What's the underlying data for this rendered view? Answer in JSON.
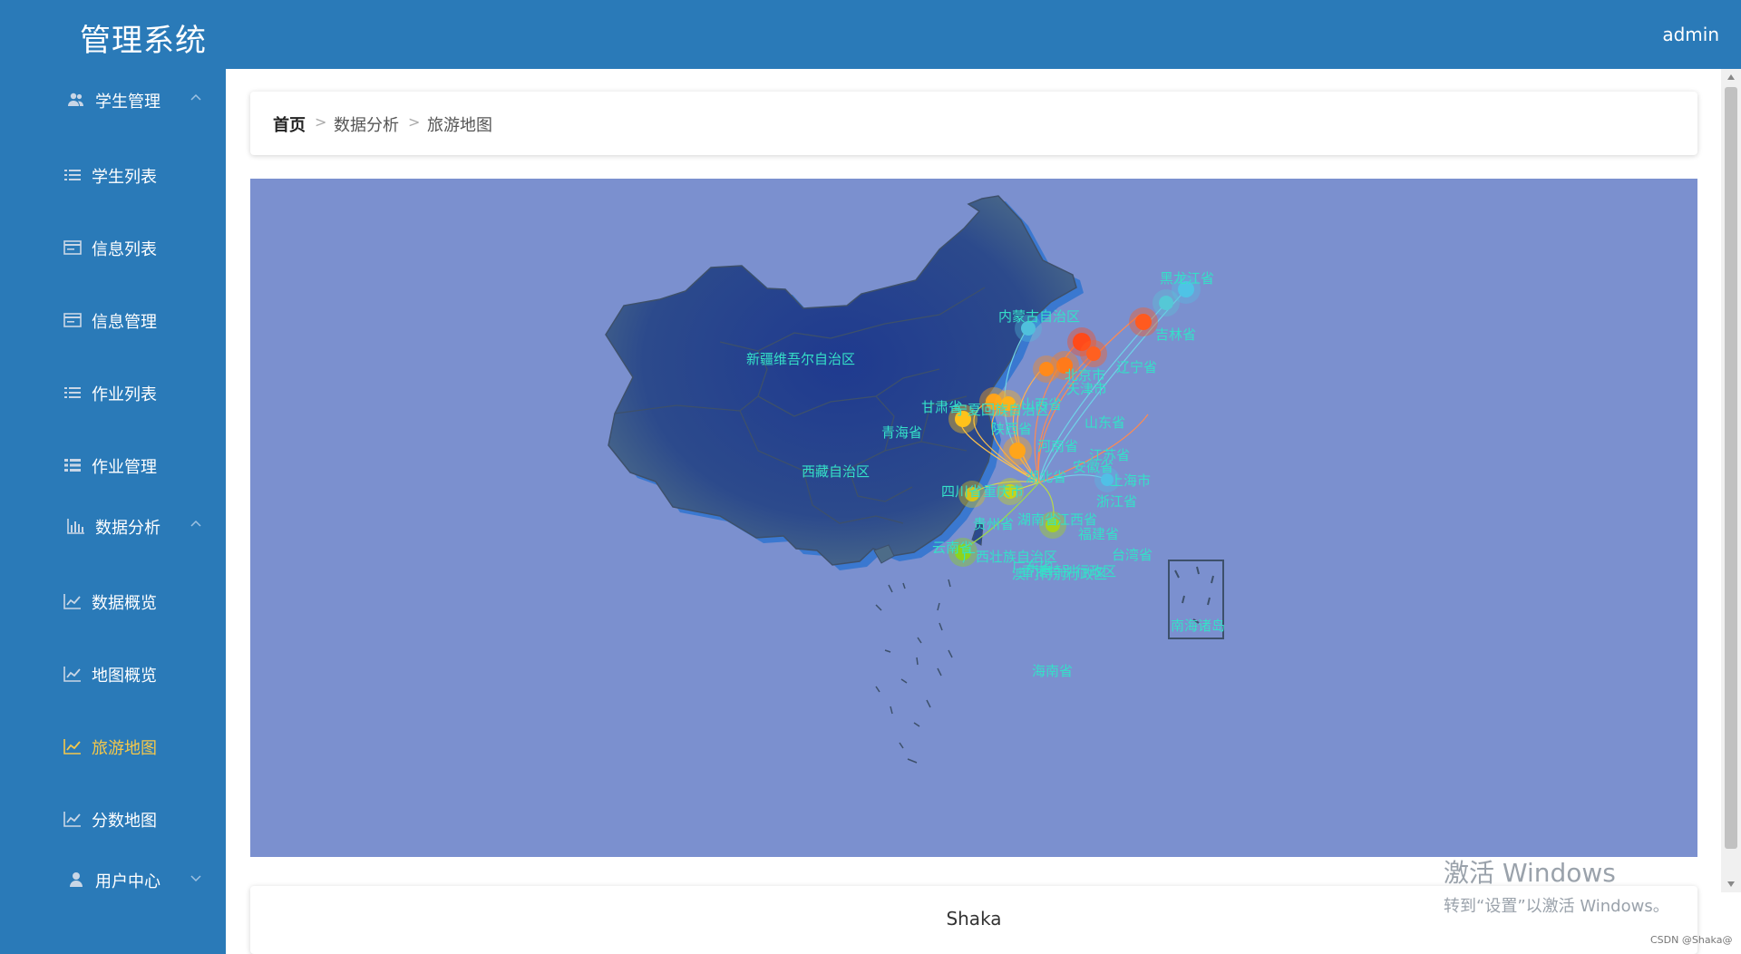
{
  "header": {
    "title": "管理系统",
    "user": "admin"
  },
  "sidebar": {
    "items": [
      {
        "label": "学生管理",
        "icon": "users-icon",
        "group": true,
        "expanded": true
      },
      {
        "label": "学生列表",
        "icon": "list-icon"
      },
      {
        "label": "信息列表",
        "icon": "card-icon"
      },
      {
        "label": "信息管理",
        "icon": "card-icon"
      },
      {
        "label": "作业列表",
        "icon": "list-icon"
      },
      {
        "label": "作业管理",
        "icon": "grid-list-icon"
      },
      {
        "label": "数据分析",
        "icon": "bar-chart-icon",
        "group": true,
        "expanded": true
      },
      {
        "label": "数据概览",
        "icon": "line-chart-icon"
      },
      {
        "label": "地图概览",
        "icon": "line-chart-icon"
      },
      {
        "label": "旅游地图",
        "icon": "line-chart-icon",
        "active": true
      },
      {
        "label": "分数地图",
        "icon": "line-chart-icon"
      },
      {
        "label": "用户中心",
        "icon": "user-icon",
        "group": true,
        "expanded": false
      }
    ]
  },
  "breadcrumb": {
    "home": "首页",
    "section": "数据分析",
    "page": "旅游地图"
  },
  "map": {
    "background": "#7b90cf",
    "province_labels": {
      "heilongjiang": "黑龙江省",
      "neimenggu": "内蒙古自治区",
      "jilin": "吉林省",
      "liaoning": "辽宁省",
      "xinjiang": "新疆维吾尔自治区",
      "beijing": "北京市",
      "tianjin": "天津市",
      "gansu": "甘肃省",
      "ningxia": "宁夏回族自治区",
      "shaanxi": "陕西省",
      "shanxi": "山西省",
      "shandong": "山东省",
      "qinghai": "青海省",
      "henan": "河南省",
      "jiangsu": "江苏省",
      "anhui": "安徽省",
      "shanghai": "上海市",
      "xizang": "西藏自治区",
      "hubei": "湖北省",
      "sichuan": "四川省",
      "chongqing": "重庆市",
      "zhejiang": "浙江省",
      "guizhou": "贵州省",
      "hunan": "湖南省",
      "jiangxi": "江西省",
      "fujian": "福建省",
      "yunnan": "云南省",
      "guangxi": "广西壮族自治区",
      "guangdong": "广东省",
      "taiwan": "台湾省",
      "hongkong": "香港特别行政区",
      "macau": "澳门特别行政区",
      "nanhai": "南海诸岛",
      "hainan": "海南省"
    },
    "hub": "湖北省",
    "scatter": [
      {
        "place": "黑龙江省",
        "color": "#4fc3e6"
      },
      {
        "place": "吉林省",
        "color": "#55c8d6"
      },
      {
        "place": "辽宁省",
        "color": "#ff5a1f"
      },
      {
        "place": "内蒙古自治区",
        "color": "#50c0dc"
      },
      {
        "place": "北京市",
        "color": "#ff4a1a"
      },
      {
        "place": "天津市",
        "color": "#ff6020"
      },
      {
        "place": "山西省",
        "color": "#ff7a1a"
      },
      {
        "place": "陕西省",
        "color": "#ffa31a"
      },
      {
        "place": "宁夏回族自治区",
        "color": "#ffc21a"
      },
      {
        "place": "甘肃省",
        "color": "#ffb21a"
      },
      {
        "place": "河南省",
        "color": "#ffa51a"
      },
      {
        "place": "四川省",
        "color": "#d9c21a"
      },
      {
        "place": "重庆市",
        "color": "#c8d41a"
      },
      {
        "place": "湖南省",
        "color": "#a8d41a"
      },
      {
        "place": "广西壮族自治区",
        "color": "#8ed41a"
      },
      {
        "place": "上海市",
        "color": "#50c0e6"
      }
    ]
  },
  "footer": {
    "text": "Shaka"
  },
  "watermark": {
    "line1": "激活 Windows",
    "line2": "转到“设置”以激活 Windows。",
    "csdn": "CSDN @Shaka@"
  }
}
